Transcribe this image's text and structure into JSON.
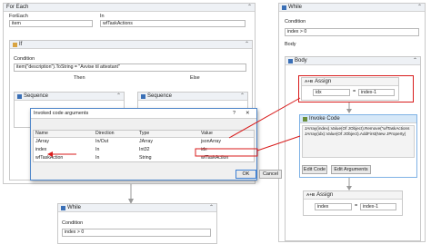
{
  "left": {
    "foreach": {
      "title": "For Each",
      "foreach_label": "ForEach",
      "foreach_value": "item",
      "in_label": "In",
      "in_value": "wfTaskActions"
    },
    "if": {
      "title": "If",
      "condition_label": "Condition",
      "condition_value": "item(\"description\").ToString = \"Avvise til attestant\"",
      "then_label": "Then",
      "else_label": "Else",
      "seq1_title": "Sequence",
      "seq2_title": "Sequence"
    },
    "while": {
      "title": "While",
      "condition_label": "Condition",
      "condition_value": "index > 0"
    }
  },
  "right": {
    "while": {
      "title": "While",
      "condition_label": "Condition",
      "condition_value": "index > 0",
      "body_label": "Body"
    },
    "body_seq_title": "Body",
    "assign1": {
      "title": "Assign",
      "left": "idx",
      "op": "=",
      "right": "index-1"
    },
    "invoke": {
      "title": "Invoke Code",
      "code_line1": "JArray(index).Value(Of JObject).Remove(\"wfTaskActions",
      "code_line2": "JArray(idx).Value(Of JObject).AddFirst(New JProperty(",
      "edit_code": "Edit Code",
      "edit_args": "Edit Arguments"
    },
    "assign2": {
      "title": "Assign",
      "left": "index",
      "op": "=",
      "right": "index-1"
    }
  },
  "dialog": {
    "title": "Invoked code arguments",
    "help": "?",
    "close": "✕",
    "columns": [
      "Name",
      "Direction",
      "Type",
      "Value"
    ],
    "rows": [
      {
        "name": "JArray",
        "direction": "In/Out",
        "type": "JArray",
        "value": "jsonArray"
      },
      {
        "name": "index",
        "direction": "In",
        "type": "Int32",
        "value": "idx"
      },
      {
        "name": "wfTaskAction",
        "direction": "In",
        "type": "String",
        "value": "wfTaskAction"
      }
    ],
    "ok": "OK",
    "cancel": "Cancel"
  },
  "colors": {
    "annotation": "#d81b1b",
    "accent": "#3c7fd4",
    "header_bg": "#eef1f5"
  }
}
